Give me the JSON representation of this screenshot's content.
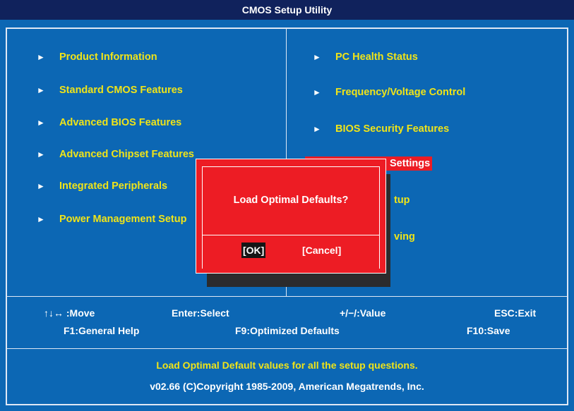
{
  "window": {
    "title": "CMOS Setup Utility"
  },
  "menu": {
    "left": [
      {
        "label": "Product Information"
      },
      {
        "label": "Standard CMOS Features"
      },
      {
        "label": "Advanced BIOS Features"
      },
      {
        "label": "Advanced Chipset Features"
      },
      {
        "label": "Integrated Peripherals"
      },
      {
        "label": "Power Management Setup"
      }
    ],
    "right": [
      {
        "label": "PC Health Status"
      },
      {
        "label": "Frequency/Voltage Control"
      },
      {
        "label": "BIOS Security Features"
      },
      {
        "label": "Settings"
      },
      {
        "label": "tup"
      },
      {
        "label": "ving"
      }
    ]
  },
  "keys": {
    "move": "↑↓↔ :Move",
    "select": "Enter:Select",
    "value": "+/−/:Value",
    "exit": "ESC:Exit",
    "help": "F1:General Help",
    "optimized": "F9:Optimized Defaults",
    "save": "F10:Save"
  },
  "footer": {
    "description": "Load Optimal Default values for all the setup questions.",
    "copyright": "v02.66 (C)Copyright 1985-2009, American Megatrends, Inc."
  },
  "dialog": {
    "message": "Load Optimal Defaults?",
    "ok_label": "[OK]",
    "cancel_label": "[Cancel]"
  },
  "colors": {
    "background": "#0c67b4",
    "title_bar": "#10225c",
    "menu_text": "#f0e418",
    "highlight": "#ec1c24",
    "dialog": "#ed1c24",
    "selected_button": "#151515"
  }
}
